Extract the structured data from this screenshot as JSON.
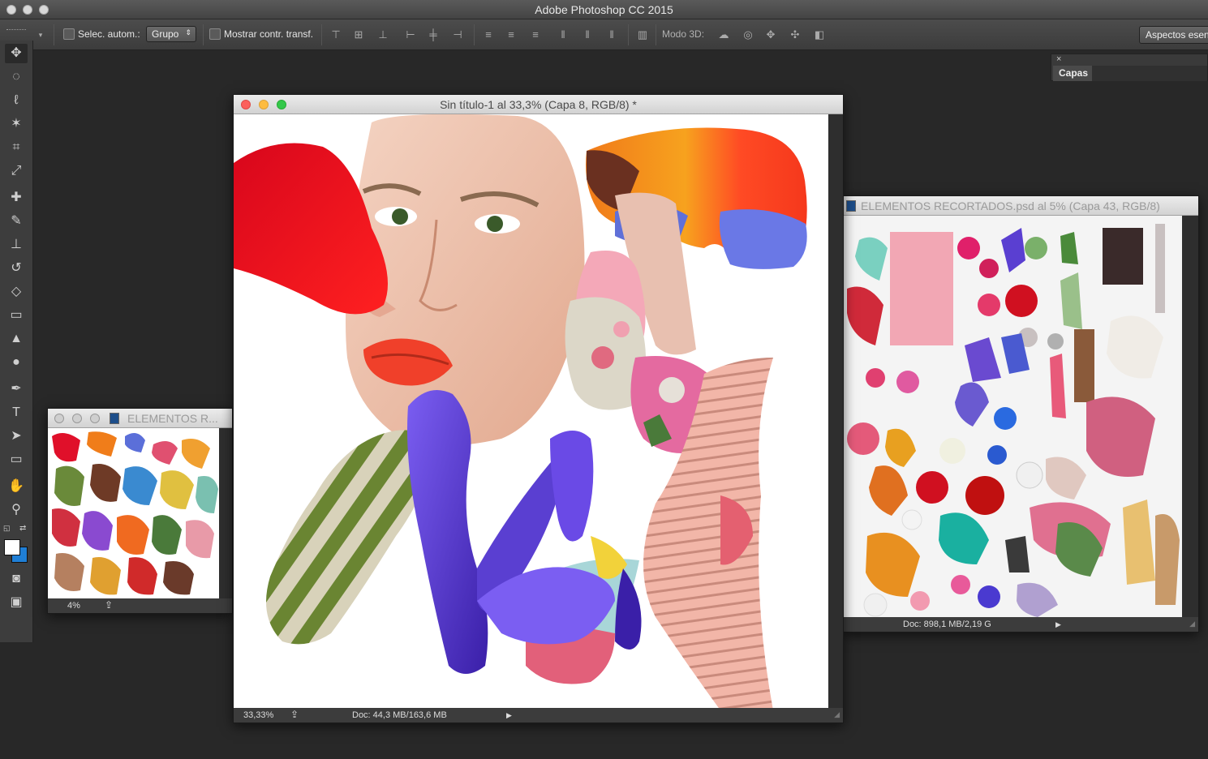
{
  "app": {
    "title": "Adobe Photoshop CC 2015"
  },
  "options": {
    "auto_select_label": "Selec. autom.:",
    "auto_select_value": "Grupo",
    "transform_label": "Mostrar contr. transf.",
    "mode3d_label": "Modo 3D:",
    "workspace_label": "Aspectos esen"
  },
  "tools": [
    "move-tool",
    "marquee-tool",
    "lasso-tool",
    "magic-wand-tool",
    "crop-tool",
    "eyedropper-tool",
    "healing-tool",
    "brush-tool",
    "stamp-tool",
    "history-brush-tool",
    "eraser-tool",
    "gradient-tool",
    "blur-tool",
    "dodge-tool",
    "pen-tool",
    "type-tool",
    "path-select-tool",
    "shape-tool",
    "hand-tool",
    "zoom-tool"
  ],
  "layers_panel": {
    "tab_label": "Capas",
    "close": "×"
  },
  "doc_main": {
    "title": "Sin título-1 al 33,3% (Capa 8, RGB/8) *",
    "zoom": "33,33%",
    "doc_info": "Doc: 44,3 MB/163,6 MB"
  },
  "doc_small": {
    "title": "ELEMENTOS R...",
    "zoom": "4%"
  },
  "doc_right": {
    "title": "ELEMENTOS RECORTADOS.psd al 5% (Capa 43, RGB/8)",
    "doc_info": "Doc: 898,1 MB/2,19 G"
  },
  "colors": {
    "foreground": "#ffffff",
    "background": "#1f7fd6",
    "accent_red": "#e0102a",
    "iris_purple": "#5a3fd1"
  }
}
